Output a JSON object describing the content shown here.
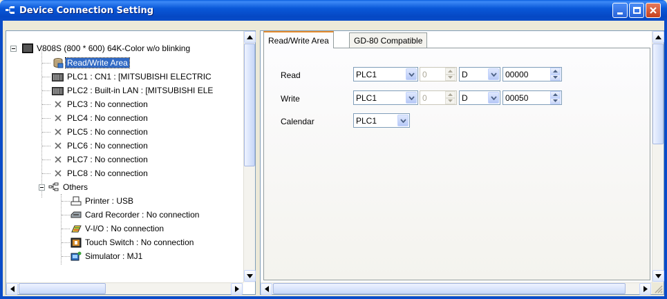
{
  "window": {
    "title": "Device Connection Setting"
  },
  "tree": {
    "root": "V808S (800 * 600) 64K-Color w/o blinking",
    "items": [
      {
        "label": "Read/Write Area",
        "icon": "database-icon",
        "selected": true
      },
      {
        "label": "PLC1 : CN1 : [MITSUBISHI ELECTRIC",
        "icon": "plc-icon"
      },
      {
        "label": "PLC2 : Built-in LAN : [MITSUBISHI ELE",
        "icon": "plc-icon"
      },
      {
        "label": "PLC3 : No connection",
        "icon": "x-icon"
      },
      {
        "label": "PLC4 : No connection",
        "icon": "x-icon"
      },
      {
        "label": "PLC5 : No connection",
        "icon": "x-icon"
      },
      {
        "label": "PLC6 : No connection",
        "icon": "x-icon"
      },
      {
        "label": "PLC7 : No connection",
        "icon": "x-icon"
      },
      {
        "label": "PLC8 : No connection",
        "icon": "x-icon"
      }
    ],
    "others": {
      "label": "Others",
      "items": [
        {
          "label": "Printer : USB",
          "icon": "printer-icon"
        },
        {
          "label": "Card Recorder : No connection",
          "icon": "card-recorder-icon"
        },
        {
          "label": "V-I/O : No connection",
          "icon": "vio-icon"
        },
        {
          "label": "Touch Switch : No connection",
          "icon": "touch-switch-icon"
        },
        {
          "label": "Simulator : MJ1",
          "icon": "simulator-icon"
        }
      ]
    }
  },
  "tabs": [
    {
      "label": "Read/Write Area",
      "active": true
    },
    {
      "label": "GD-80 Compatible",
      "active": false
    }
  ],
  "form": {
    "read": {
      "label": "Read",
      "plc": "PLC1",
      "port": "0",
      "device": "D",
      "address": "00000"
    },
    "write": {
      "label": "Write",
      "plc": "PLC1",
      "port": "0",
      "device": "D",
      "address": "00050"
    },
    "calendar": {
      "label": "Calendar",
      "plc": "PLC1"
    }
  },
  "colors": {
    "titlebar": "#0a58d8",
    "selection": "#316ac5",
    "tab_highlight": "#e68b2c"
  }
}
